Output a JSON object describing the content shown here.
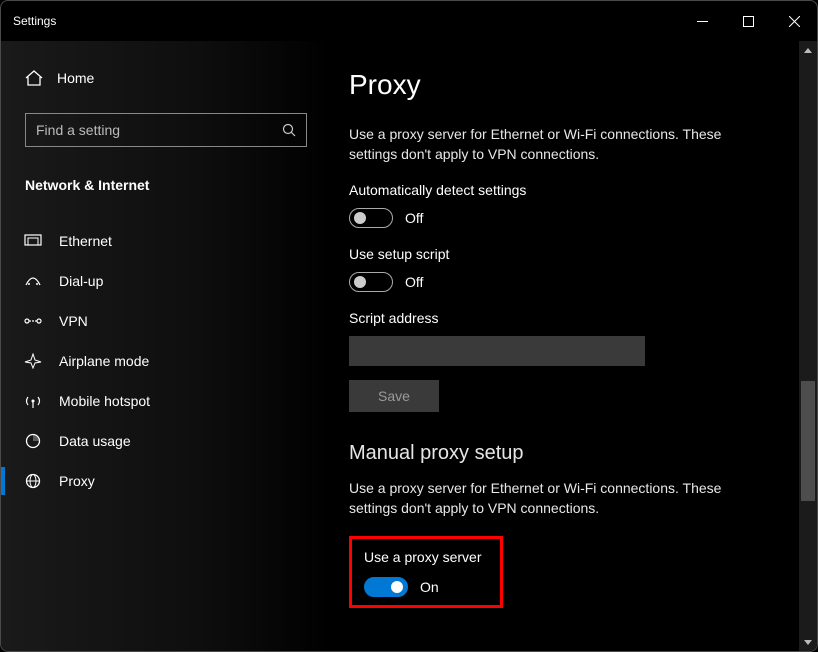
{
  "titlebar": {
    "title": "Settings"
  },
  "sidebar": {
    "home_label": "Home",
    "search_placeholder": "Find a setting",
    "category": "Network & Internet",
    "items": [
      {
        "label": "Ethernet"
      },
      {
        "label": "Dial-up"
      },
      {
        "label": "VPN"
      },
      {
        "label": "Airplane mode"
      },
      {
        "label": "Mobile hotspot"
      },
      {
        "label": "Data usage"
      },
      {
        "label": "Proxy"
      }
    ]
  },
  "main": {
    "title": "Proxy",
    "auto_desc": "Use a proxy server for Ethernet or Wi-Fi connections. These settings don't apply to VPN connections.",
    "auto_detect_label": "Automatically detect settings",
    "auto_detect_state": "Off",
    "setup_script_label": "Use setup script",
    "setup_script_state": "Off",
    "script_address_label": "Script address",
    "script_address_value": "",
    "save_label": "Save",
    "manual_heading": "Manual proxy setup",
    "manual_desc": "Use a proxy server for Ethernet or Wi-Fi connections. These settings don't apply to VPN connections.",
    "use_proxy_label": "Use a proxy server",
    "use_proxy_state": "On"
  }
}
